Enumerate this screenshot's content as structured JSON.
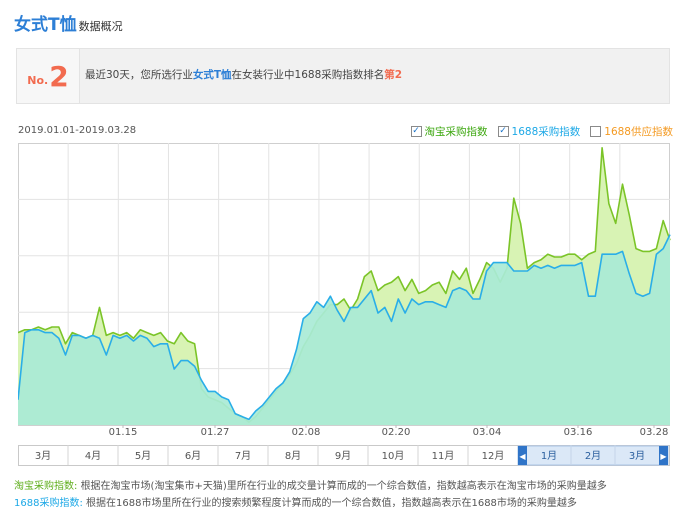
{
  "header": {
    "title": "女式T恤",
    "subtitle": "数据概况"
  },
  "rank": {
    "prefix": "No.",
    "number": "2",
    "text_before": "最近30天，您所选行业",
    "category": "女式T恤",
    "text_middle": "在女装行业中1688采购指数排名",
    "rank_label": "第2"
  },
  "date_range": "2019.01.01-2019.03.28",
  "legend": [
    {
      "label": "淘宝采购指数",
      "checked": true,
      "check_mark": "✓",
      "color": "#5aa81a"
    },
    {
      "label": "1688采购指数",
      "checked": true,
      "check_mark": "✓",
      "color": "#1ca8e6"
    },
    {
      "label": "1688供应指数",
      "checked": false,
      "check_mark": "",
      "color": "#f49a22"
    }
  ],
  "chart_data": {
    "type": "area",
    "x_tick_labels": [
      "01.15",
      "01.27",
      "02.08",
      "02.20",
      "03.04",
      "03.16",
      "03.28"
    ],
    "ylim": [
      0,
      100
    ],
    "grid": true,
    "series": [
      {
        "name": "淘宝采购指数",
        "color": "#7bc428",
        "fill": "#d8f3b4",
        "values": [
          33,
          34,
          34,
          35,
          34,
          35,
          35,
          29,
          33,
          32,
          31,
          32,
          42,
          32,
          33,
          32,
          33,
          31,
          34,
          33,
          32,
          33,
          30,
          29,
          33,
          30,
          29,
          13,
          10,
          9,
          8,
          6,
          4,
          3,
          1,
          3,
          6,
          9,
          12,
          15,
          18,
          22,
          28,
          32,
          37,
          40,
          43,
          43,
          45,
          41,
          45,
          53,
          55,
          48,
          50,
          51,
          53,
          48,
          52,
          47,
          48,
          50,
          51,
          47,
          55,
          52,
          56,
          47,
          52,
          58,
          56,
          51,
          56,
          81,
          72,
          56,
          58,
          59,
          61,
          60,
          60,
          61,
          61,
          59,
          61,
          62,
          99,
          79,
          72,
          86,
          75,
          63,
          62,
          62,
          63,
          73,
          66
        ]
      },
      {
        "name": "1688采购指数",
        "color": "#2aaee8",
        "fill": "#a9ead6",
        "values": [
          9,
          33,
          34,
          34,
          33,
          33,
          31,
          25,
          32,
          32,
          31,
          32,
          31,
          25,
          32,
          31,
          32,
          30,
          32,
          31,
          28,
          29,
          29,
          20,
          23,
          23,
          21,
          16,
          12,
          12,
          10,
          9,
          4,
          3,
          2,
          5,
          7,
          10,
          13,
          15,
          19,
          27,
          38,
          40,
          44,
          42,
          46,
          41,
          37,
          42,
          42,
          45,
          48,
          40,
          42,
          37,
          45,
          40,
          45,
          43,
          44,
          44,
          43,
          42,
          48,
          49,
          48,
          45,
          45,
          55,
          58,
          58,
          58,
          55,
          55,
          55,
          57,
          56,
          57,
          56,
          57,
          57,
          57,
          58,
          46,
          46,
          61,
          61,
          61,
          62,
          54,
          47,
          46,
          47,
          61,
          63,
          68
        ]
      }
    ]
  },
  "timeline": {
    "left_months": [
      "3月",
      "4月",
      "5月",
      "6月",
      "7月",
      "8月",
      "9月",
      "10月",
      "11月",
      "12月"
    ],
    "selected_months": [
      "1月",
      "2月",
      "3月"
    ],
    "prev_arrow": "◀",
    "next_arrow": "▶"
  },
  "footnotes": [
    {
      "label": "淘宝采购指数:",
      "text": "根据在淘宝市场(淘宝集市+天猫)里所在行业的成交量计算而成的一个综合数值，指数越高表示在淘宝市场的采购量越多"
    },
    {
      "label": "1688采购指数:",
      "text": "根据在1688市场里所在行业的搜索频繁程度计算而成的一个综合数值，指数越高表示在1688市场的采购量越多"
    }
  ]
}
